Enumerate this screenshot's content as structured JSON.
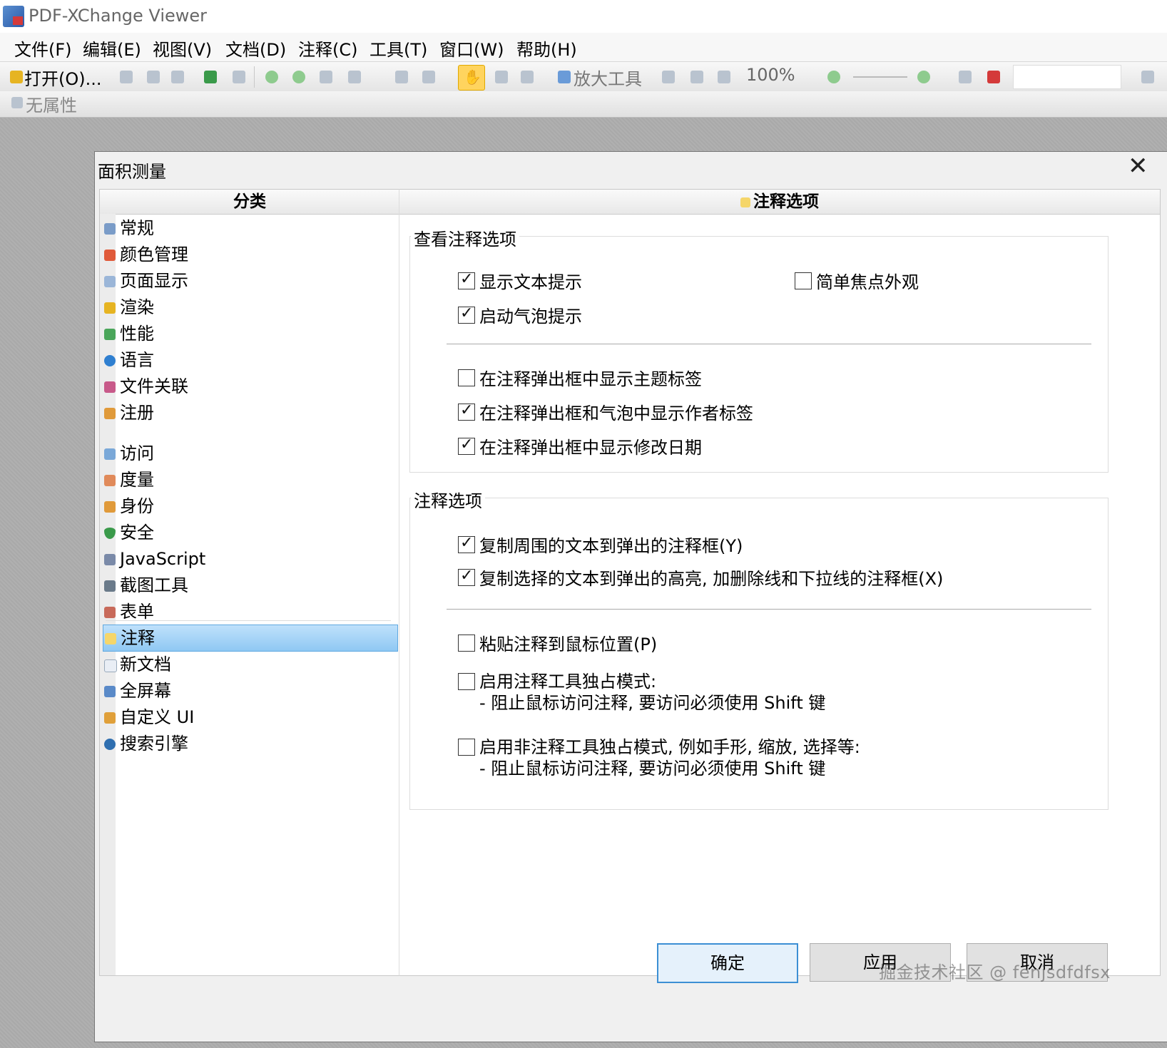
{
  "app": {
    "title": "PDF-XChange Viewer"
  },
  "menu": [
    "文件(F)",
    "编辑(E)",
    "视图(V)",
    "文档(D)",
    "注释(C)",
    "工具(T)",
    "窗口(W)",
    "帮助(H)"
  ],
  "toolbar": {
    "open_label": "打开(O)...",
    "zoom_tool_label": "放大工具",
    "zoom_value": "100%",
    "properties_label": "无属性"
  },
  "dialog": {
    "title": "面积测量",
    "categories_header": "分类",
    "options_header": "注释选项",
    "categories": [
      "常规",
      "颜色管理",
      "页面显示",
      "渲染",
      "性能",
      "语言",
      "文件关联",
      "注册",
      "访问",
      "度量",
      "身份",
      "安全",
      "JavaScript",
      "截图工具",
      "表单",
      "注释",
      "新文档",
      "全屏幕",
      "自定义 UI",
      "搜索引擎"
    ],
    "selected_category": "注释",
    "view_group": {
      "title": "查看注释选项",
      "options": [
        {
          "label": "显示文本提示",
          "checked": true
        },
        {
          "label": "简单焦点外观",
          "checked": false
        },
        {
          "label": "启动气泡提示",
          "checked": true
        },
        {
          "label": "在注释弹出框中显示主题标签",
          "checked": false
        },
        {
          "label": "在注释弹出框和气泡中显示作者标签",
          "checked": true
        },
        {
          "label": "在注释弹出框中显示修改日期",
          "checked": true
        }
      ]
    },
    "annot_group": {
      "title": "注释选项",
      "options": [
        {
          "label": "复制周围的文本到弹出的注释框(Y)",
          "checked": true
        },
        {
          "label": "复制选择的文本到弹出的高亮, 加删除线和下拉线的注释框(X)",
          "checked": true
        },
        {
          "label": "粘贴注释到鼠标位置(P)",
          "checked": false
        },
        {
          "label": "启用注释工具独占模式:",
          "sub": "- 阻止鼠标访问注释, 要访问必须使用 Shift 键",
          "checked": false
        },
        {
          "label": "启用非注释工具独占模式, 例如手形, 缩放, 选择等:",
          "sub": "- 阻止鼠标访问注释, 要访问必须使用 Shift 键",
          "checked": false
        }
      ]
    },
    "buttons": {
      "ok": "确定",
      "apply": "应用",
      "cancel": "取消"
    }
  },
  "watermark": "掘金技术社区 @ fenjsdfdfsx",
  "colors": {
    "selection": "#9fd0f6",
    "accent": "#3c8fd4",
    "workspace": "#a9a9a9"
  }
}
